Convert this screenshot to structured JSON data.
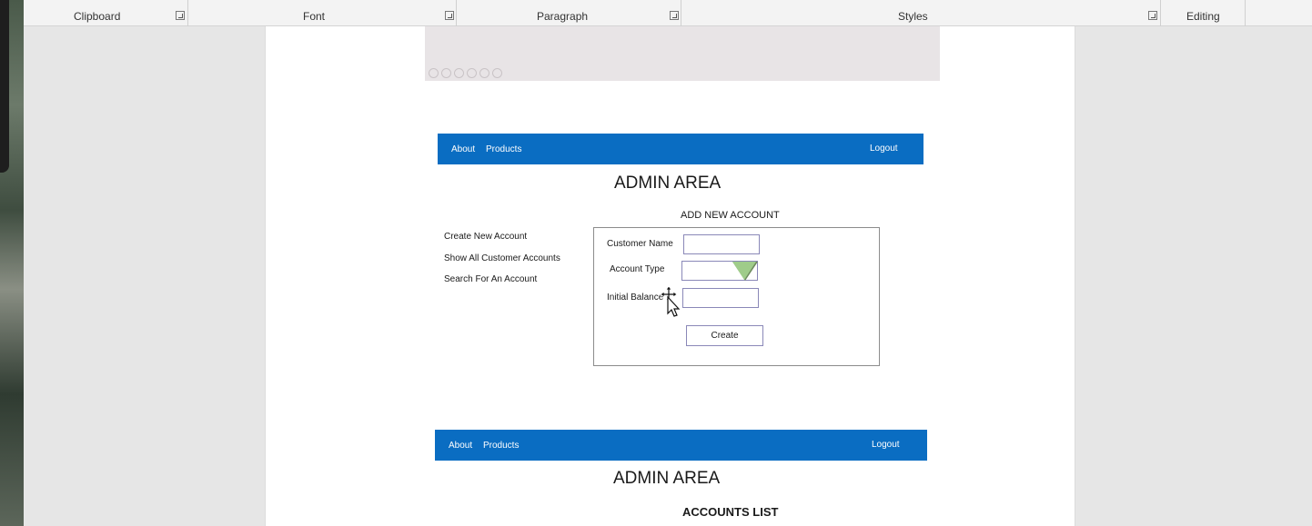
{
  "ribbon": {
    "groups": [
      {
        "label": "Clipboard"
      },
      {
        "label": "Font"
      },
      {
        "label": "Paragraph"
      },
      {
        "label": "Styles"
      },
      {
        "label": "Editing"
      }
    ]
  },
  "mockup1": {
    "nav_about": "About",
    "nav_products": "Products",
    "nav_logout": "Logout",
    "title": "ADMIN AREA",
    "section_title": "ADD NEW ACCOUNT",
    "side_links": [
      "Create New Account",
      "Show All Customer Accounts",
      "Search For An Account"
    ],
    "form": {
      "customer_name_label": "Customer Name",
      "account_type_label": "Account Type",
      "initial_balance_label": "Initial Balance",
      "create_label": "Create"
    }
  },
  "mockup2": {
    "nav_about": "About",
    "nav_products": "Products",
    "nav_logout": "Logout",
    "title": "ADMIN AREA",
    "section_title": "ACCOUNTS LIST"
  },
  "colors": {
    "navbar": "#0a6dc2",
    "dropdown_arrow": "#9fcc8a",
    "input_border": "#8a88b8"
  }
}
